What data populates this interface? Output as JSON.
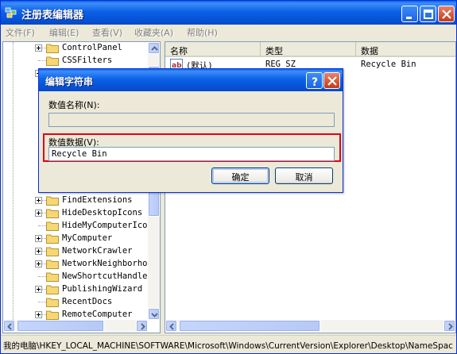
{
  "window": {
    "title": "注册表编辑器"
  },
  "menu": [
    "文件(F)",
    "编辑(E)",
    "查看(V)",
    "收藏夹(A)",
    "帮助(H)"
  ],
  "tree": {
    "items": [
      {
        "label": "ControlPanel",
        "expander": true
      },
      {
        "label": "CSSFilters",
        "expander": false
      },
      {
        "label": "",
        "expander": true
      },
      {
        "label": "FindExtensions",
        "expander": true
      },
      {
        "label": "HideDesktopIcons",
        "expander": true
      },
      {
        "label": "HideMyComputerIcons",
        "expander": false
      },
      {
        "label": "MyComputer",
        "expander": true
      },
      {
        "label": "NetworkCrawler",
        "expander": true
      },
      {
        "label": "NetworkNeighborhood",
        "expander": true
      },
      {
        "label": "NewShortcutHandlers",
        "expander": false
      },
      {
        "label": "PublishingWizard",
        "expander": true
      },
      {
        "label": "RecentDocs",
        "expander": false
      },
      {
        "label": "RemoteComputer",
        "expander": true
      }
    ]
  },
  "list": {
    "columns": [
      "名称",
      "类型",
      "数据"
    ],
    "rows": [
      {
        "name": "(默认)",
        "type": "REG_SZ",
        "data": "Recycle Bin",
        "icon": "string-value-icon"
      }
    ]
  },
  "status": {
    "path": "我的电脑\\HKEY_LOCAL_MACHINE\\SOFTWARE\\Microsoft\\Windows\\CurrentVersion\\Explorer\\Desktop\\NameSpace"
  },
  "dialog": {
    "title": "编辑字符串",
    "name_label": "数值名称(N):",
    "name_value": "",
    "data_label": "数值数据(V):",
    "data_value": "Recycle Bin",
    "ok_label": "确定",
    "cancel_label": "取消",
    "help_glyph": "?"
  },
  "colors": {
    "titlebar": "#0552d6",
    "highlight_border": "#e0001b",
    "folder": "#f5d776"
  }
}
